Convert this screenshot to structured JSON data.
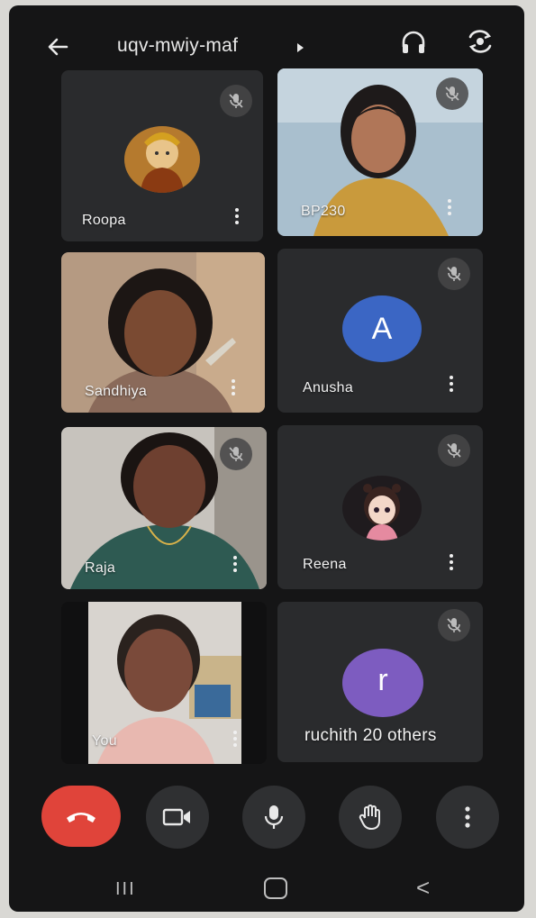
{
  "header": {
    "meeting_code": "uqv-mwiy-maf",
    "icons": [
      "back-arrow-icon",
      "caret-right-icon",
      "headphones-icon",
      "switch-camera-icon"
    ]
  },
  "participants": [
    {
      "name": "Roopa",
      "muted": true,
      "tile": "avatar-image"
    },
    {
      "name": "BP230",
      "muted": true,
      "tile": "video"
    },
    {
      "name": "Sandhiya",
      "muted": false,
      "tile": "video"
    },
    {
      "name": "Anusha",
      "muted": true,
      "tile": "letter-avatar",
      "initial": "A",
      "color": "#3b66c4"
    },
    {
      "name": "Raja",
      "muted": true,
      "tile": "video"
    },
    {
      "name": "Reena",
      "muted": true,
      "tile": "avatar-image"
    },
    {
      "name": "You",
      "muted": false,
      "tile": "video"
    },
    {
      "name": "ruchith 20 others",
      "muted": true,
      "tile": "letter-avatar",
      "initial": "r",
      "color": "#7d5cc0"
    }
  ],
  "controls": [
    {
      "name": "end-call",
      "icon": "phone-hangup-icon",
      "color": "#e0443a"
    },
    {
      "name": "camera",
      "icon": "video-camera-icon"
    },
    {
      "name": "microphone",
      "icon": "microphone-icon"
    },
    {
      "name": "raise-hand",
      "icon": "hand-icon"
    },
    {
      "name": "more-options",
      "icon": "vertical-dots-icon"
    }
  ],
  "nav": {
    "recents": "III",
    "home": "home-icon",
    "back": "<"
  }
}
